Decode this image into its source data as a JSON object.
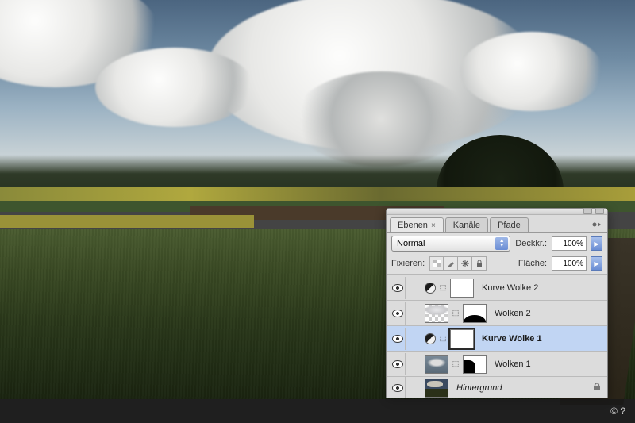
{
  "footer": {
    "copyright": "© ?"
  },
  "panel": {
    "tabs": {
      "layers": "Ebenen",
      "channels": "Kanäle",
      "paths": "Pfade"
    },
    "opacity_label": "Deckkr.:",
    "opacity_value": "100%",
    "fill_label": "Fläche:",
    "fill_value": "100%",
    "blend_mode": "Normal",
    "lock_label": "Fixieren:",
    "layers": [
      {
        "name": "Kurve Wolke 2"
      },
      {
        "name": "Wolken 2"
      },
      {
        "name": "Kurve Wolke 1"
      },
      {
        "name": "Wolken 1"
      },
      {
        "name": "Hintergrund"
      }
    ]
  }
}
